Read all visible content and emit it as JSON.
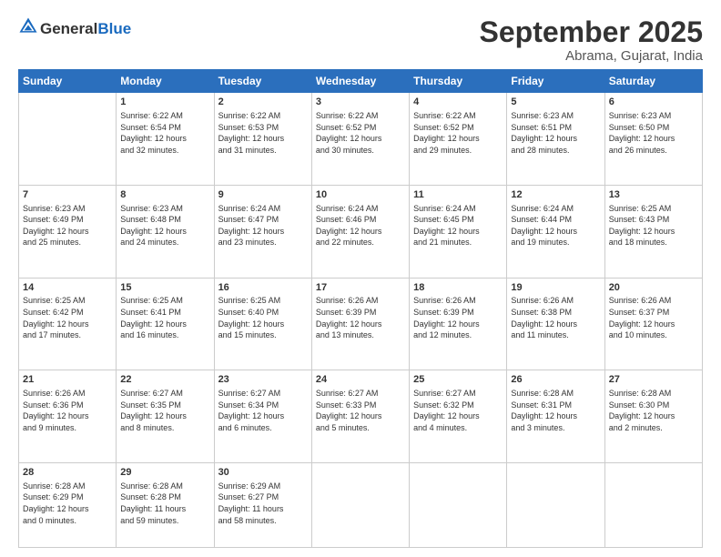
{
  "logo": {
    "general": "General",
    "blue": "Blue"
  },
  "header": {
    "month": "September 2025",
    "location": "Abrama, Gujarat, India"
  },
  "weekdays": [
    "Sunday",
    "Monday",
    "Tuesday",
    "Wednesday",
    "Thursday",
    "Friday",
    "Saturday"
  ],
  "weeks": [
    [
      {
        "day": "",
        "info": ""
      },
      {
        "day": "1",
        "info": "Sunrise: 6:22 AM\nSunset: 6:54 PM\nDaylight: 12 hours\nand 32 minutes."
      },
      {
        "day": "2",
        "info": "Sunrise: 6:22 AM\nSunset: 6:53 PM\nDaylight: 12 hours\nand 31 minutes."
      },
      {
        "day": "3",
        "info": "Sunrise: 6:22 AM\nSunset: 6:52 PM\nDaylight: 12 hours\nand 30 minutes."
      },
      {
        "day": "4",
        "info": "Sunrise: 6:22 AM\nSunset: 6:52 PM\nDaylight: 12 hours\nand 29 minutes."
      },
      {
        "day": "5",
        "info": "Sunrise: 6:23 AM\nSunset: 6:51 PM\nDaylight: 12 hours\nand 28 minutes."
      },
      {
        "day": "6",
        "info": "Sunrise: 6:23 AM\nSunset: 6:50 PM\nDaylight: 12 hours\nand 26 minutes."
      }
    ],
    [
      {
        "day": "7",
        "info": "Sunrise: 6:23 AM\nSunset: 6:49 PM\nDaylight: 12 hours\nand 25 minutes."
      },
      {
        "day": "8",
        "info": "Sunrise: 6:23 AM\nSunset: 6:48 PM\nDaylight: 12 hours\nand 24 minutes."
      },
      {
        "day": "9",
        "info": "Sunrise: 6:24 AM\nSunset: 6:47 PM\nDaylight: 12 hours\nand 23 minutes."
      },
      {
        "day": "10",
        "info": "Sunrise: 6:24 AM\nSunset: 6:46 PM\nDaylight: 12 hours\nand 22 minutes."
      },
      {
        "day": "11",
        "info": "Sunrise: 6:24 AM\nSunset: 6:45 PM\nDaylight: 12 hours\nand 21 minutes."
      },
      {
        "day": "12",
        "info": "Sunrise: 6:24 AM\nSunset: 6:44 PM\nDaylight: 12 hours\nand 19 minutes."
      },
      {
        "day": "13",
        "info": "Sunrise: 6:25 AM\nSunset: 6:43 PM\nDaylight: 12 hours\nand 18 minutes."
      }
    ],
    [
      {
        "day": "14",
        "info": "Sunrise: 6:25 AM\nSunset: 6:42 PM\nDaylight: 12 hours\nand 17 minutes."
      },
      {
        "day": "15",
        "info": "Sunrise: 6:25 AM\nSunset: 6:41 PM\nDaylight: 12 hours\nand 16 minutes."
      },
      {
        "day": "16",
        "info": "Sunrise: 6:25 AM\nSunset: 6:40 PM\nDaylight: 12 hours\nand 15 minutes."
      },
      {
        "day": "17",
        "info": "Sunrise: 6:26 AM\nSunset: 6:39 PM\nDaylight: 12 hours\nand 13 minutes."
      },
      {
        "day": "18",
        "info": "Sunrise: 6:26 AM\nSunset: 6:39 PM\nDaylight: 12 hours\nand 12 minutes."
      },
      {
        "day": "19",
        "info": "Sunrise: 6:26 AM\nSunset: 6:38 PM\nDaylight: 12 hours\nand 11 minutes."
      },
      {
        "day": "20",
        "info": "Sunrise: 6:26 AM\nSunset: 6:37 PM\nDaylight: 12 hours\nand 10 minutes."
      }
    ],
    [
      {
        "day": "21",
        "info": "Sunrise: 6:26 AM\nSunset: 6:36 PM\nDaylight: 12 hours\nand 9 minutes."
      },
      {
        "day": "22",
        "info": "Sunrise: 6:27 AM\nSunset: 6:35 PM\nDaylight: 12 hours\nand 8 minutes."
      },
      {
        "day": "23",
        "info": "Sunrise: 6:27 AM\nSunset: 6:34 PM\nDaylight: 12 hours\nand 6 minutes."
      },
      {
        "day": "24",
        "info": "Sunrise: 6:27 AM\nSunset: 6:33 PM\nDaylight: 12 hours\nand 5 minutes."
      },
      {
        "day": "25",
        "info": "Sunrise: 6:27 AM\nSunset: 6:32 PM\nDaylight: 12 hours\nand 4 minutes."
      },
      {
        "day": "26",
        "info": "Sunrise: 6:28 AM\nSunset: 6:31 PM\nDaylight: 12 hours\nand 3 minutes."
      },
      {
        "day": "27",
        "info": "Sunrise: 6:28 AM\nSunset: 6:30 PM\nDaylight: 12 hours\nand 2 minutes."
      }
    ],
    [
      {
        "day": "28",
        "info": "Sunrise: 6:28 AM\nSunset: 6:29 PM\nDaylight: 12 hours\nand 0 minutes."
      },
      {
        "day": "29",
        "info": "Sunrise: 6:28 AM\nSunset: 6:28 PM\nDaylight: 11 hours\nand 59 minutes."
      },
      {
        "day": "30",
        "info": "Sunrise: 6:29 AM\nSunset: 6:27 PM\nDaylight: 11 hours\nand 58 minutes."
      },
      {
        "day": "",
        "info": ""
      },
      {
        "day": "",
        "info": ""
      },
      {
        "day": "",
        "info": ""
      },
      {
        "day": "",
        "info": ""
      }
    ]
  ]
}
